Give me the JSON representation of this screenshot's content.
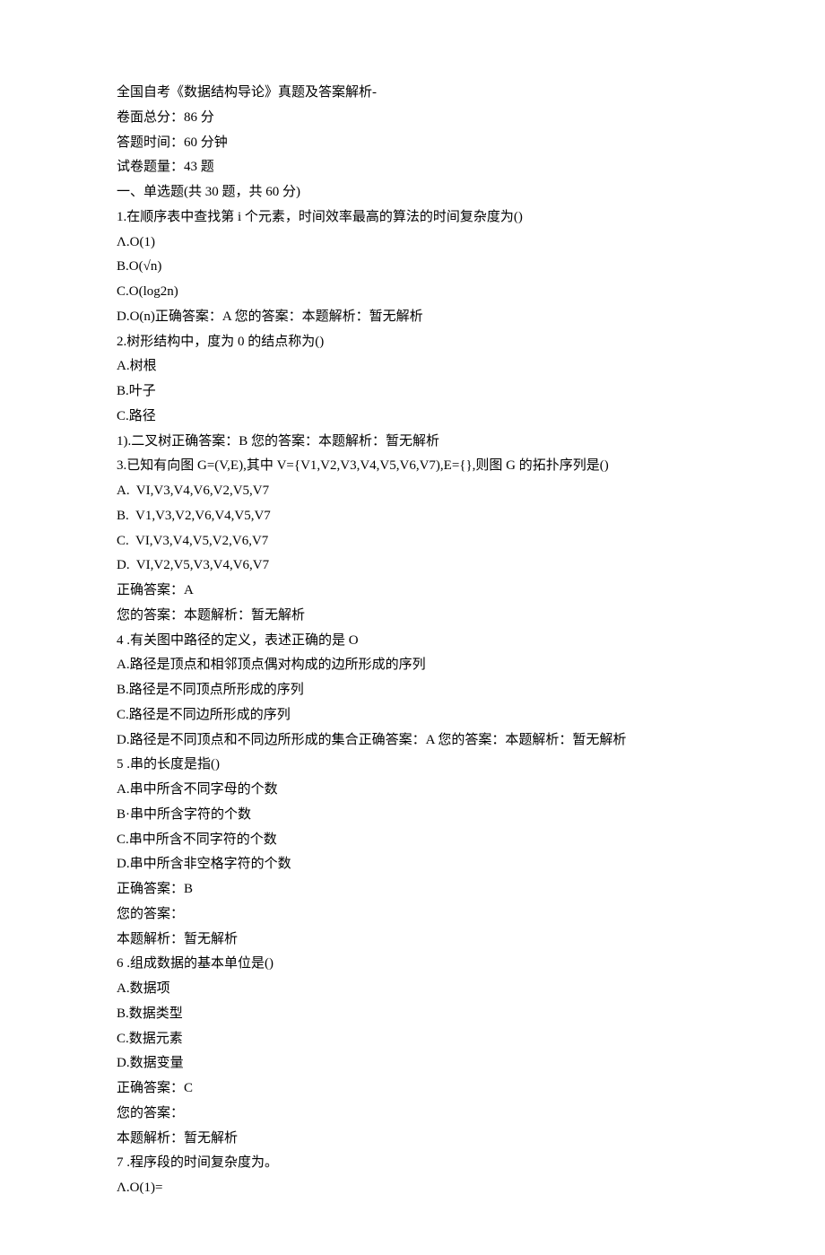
{
  "title": "全国自考《数据结构导论》真题及答案解析-",
  "meta": {
    "total_score": "卷面总分：86 分",
    "duration": "答题时间：60 分钟",
    "question_count": "试卷题量：43 题"
  },
  "section1_header": "一、单选题(共 30 题，共 60 分)",
  "q1": {
    "stem": "1.在顺序表中查找第 i 个元素，时间效率最高的算法的时间复杂度为()",
    "A": "Λ.O(1)",
    "B": "B.O(√n)",
    "C": "C.O(log2n)",
    "D": "D.O(n)正确答案：A 您的答案：本题解析：暂无解析"
  },
  "q2": {
    "stem": "2.树形结构中，度为 0 的结点称为()",
    "A": "A.树根",
    "B": "B.叶子",
    "C": "C.路径",
    "D": "1).二叉树正确答案：B 您的答案：本题解析：暂无解析"
  },
  "q3": {
    "stem": "3.已知有向图 G=(V,E),其中 V={V1,V2,V3,V4,V5,V6,V7),E={},则图 G 的拓扑序列是()",
    "A": "A.  VI,V3,V4,V6,V2,V5,V7",
    "B": "B.  V1,V3,V2,V6,V4,V5,V7",
    "C": "C.  VI,V3,V4,V5,V2,V6,V7",
    "D": "D.  VI,V2,V5,V3,V4,V6,V7",
    "answer": "正确答案：A",
    "your": "您的答案：本题解析：暂无解析"
  },
  "q4": {
    "stem": "4 .有关图中路径的定义，表述正确的是 O",
    "A": "A.路径是顶点和相邻顶点偶对构成的边所形成的序列",
    "B": "B.路径是不同顶点所形成的序列",
    "C": "C.路径是不同边所形成的序列",
    "D": "D.路径是不同顶点和不同边所形成的集合正确答案：A 您的答案：本题解析：暂无解析"
  },
  "q5": {
    "stem": "5 .串的长度是指()",
    "A": "A.串中所含不同字母的个数",
    "B": "B·串中所含字符的个数",
    "C": "C.串中所含不同字符的个数",
    "D": "D.串中所含非空格字符的个数",
    "answer": "正确答案：B",
    "your": "您的答案：",
    "analysis": "本题解析：暂无解析"
  },
  "q6": {
    "stem": "6 .组成数据的基本单位是()",
    "A": "A.数据项",
    "B": "B.数据类型",
    "C": "C.数据元素",
    "D": "D.数据变量",
    "answer": "正确答案：C",
    "your": "您的答案：",
    "analysis": "本题解析：暂无解析"
  },
  "q7": {
    "stem": "7 .程序段的时间复杂度为。",
    "A": "Λ.O(1)="
  }
}
